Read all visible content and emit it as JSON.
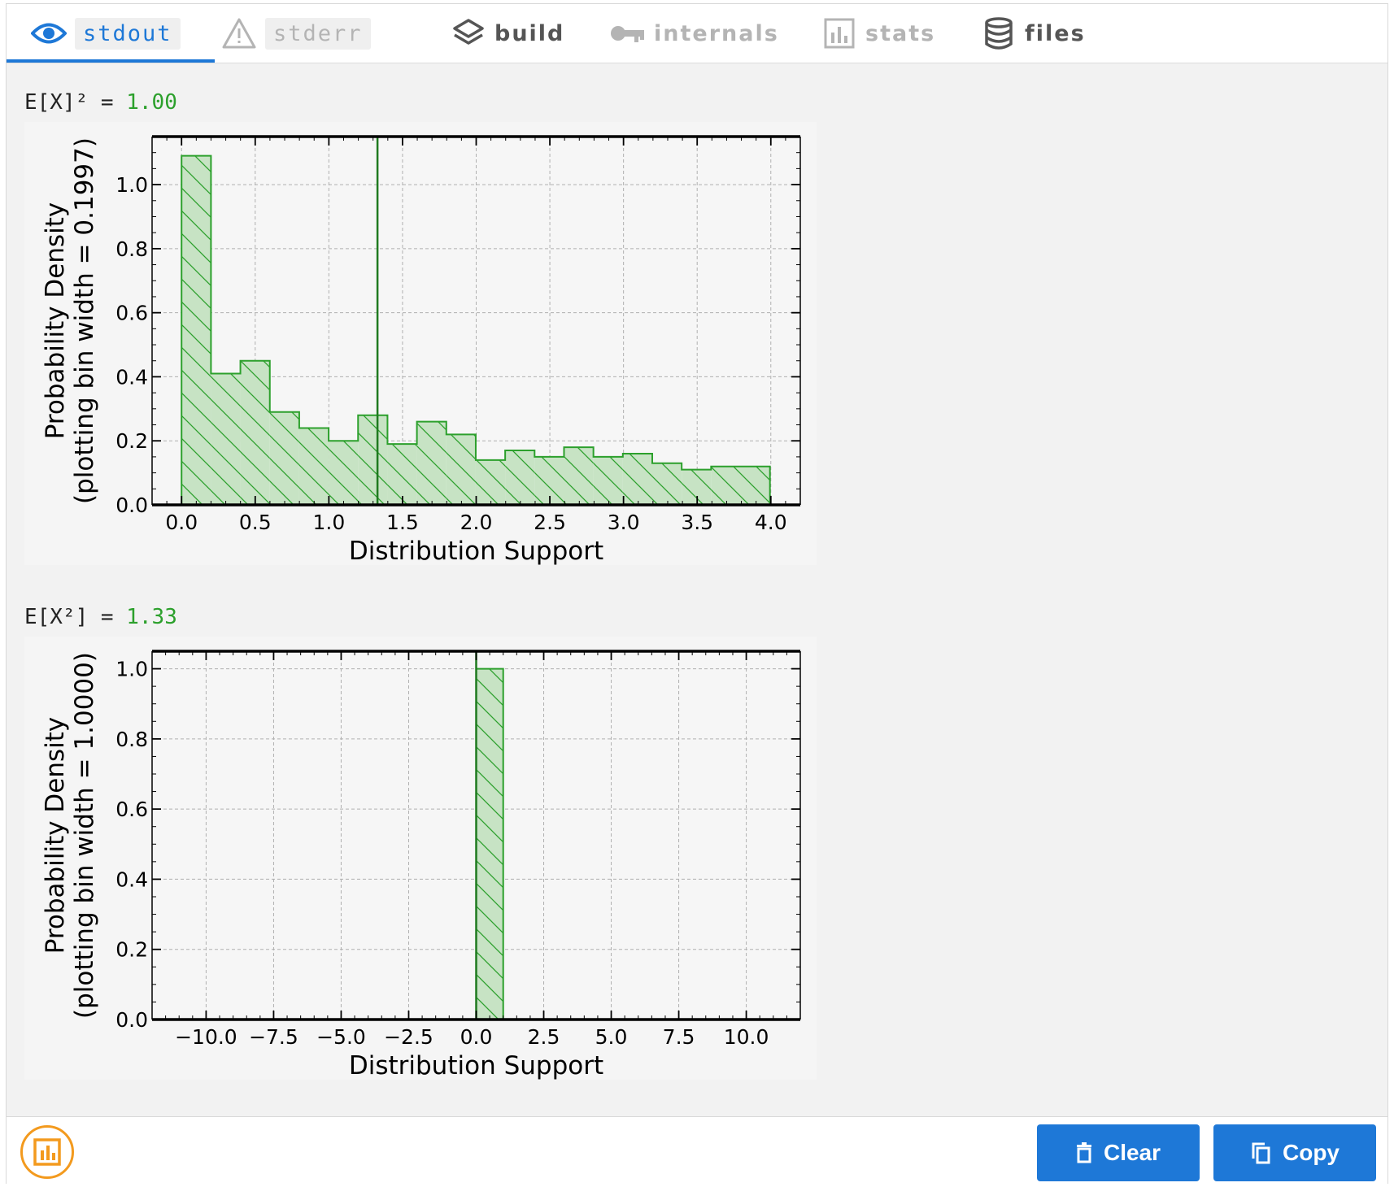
{
  "tabs": [
    {
      "label": "stdout",
      "icon": "eye-icon",
      "state": "active"
    },
    {
      "label": "stderr",
      "icon": "warning-icon",
      "state": "disabled"
    },
    {
      "label": "build",
      "icon": "layers-icon",
      "state": "normal"
    },
    {
      "label": "internals",
      "icon": "key-icon",
      "state": "disabled"
    },
    {
      "label": "stats",
      "icon": "bar-chart-icon",
      "state": "disabled"
    },
    {
      "label": "files",
      "icon": "database-icon",
      "state": "normal"
    }
  ],
  "outputs": [
    {
      "expr_label": "E[X]² = ",
      "expr_value": "1.00"
    },
    {
      "expr_label": "E[X²] = ",
      "expr_value": "1.33"
    }
  ],
  "footer": {
    "fab_icon": "bar-chart-icon",
    "clear_label": "Clear",
    "copy_label": "Copy"
  },
  "colors": {
    "accent": "#1e78d7",
    "hist_fill": "#c7e3c4",
    "hist_edge": "#2ca02c",
    "mean_line": "#1f7a1f",
    "fab": "#f39a1e"
  },
  "chart_data": [
    {
      "type": "bar",
      "title": "",
      "xlabel": "Distribution Support",
      "ylabel": "Probability Density\n(plotting bin width = 0.1997)",
      "xlim": [
        -0.2,
        4.2
      ],
      "ylim": [
        0.0,
        1.15
      ],
      "xticks": [
        0.0,
        0.5,
        1.0,
        1.5,
        2.0,
        2.5,
        3.0,
        3.5,
        4.0
      ],
      "xtick_labels": [
        "0.0",
        "0.5",
        "1.0",
        "1.5",
        "2.0",
        "2.5",
        "3.0",
        "3.5",
        "4.0"
      ],
      "yticks": [
        0.0,
        0.2,
        0.4,
        0.6,
        0.8,
        1.0
      ],
      "ytick_labels": [
        "0.0",
        "0.2",
        "0.4",
        "0.6",
        "0.8",
        "1.0"
      ],
      "grid": true,
      "bin_start": 0.0,
      "bin_width": 0.1997,
      "values": [
        1.09,
        0.41,
        0.45,
        0.29,
        0.24,
        0.2,
        0.28,
        0.19,
        0.26,
        0.22,
        0.14,
        0.17,
        0.15,
        0.18,
        0.15,
        0.16,
        0.13,
        0.11,
        0.12,
        0.12
      ],
      "vline": 1.33
    },
    {
      "type": "bar",
      "title": "",
      "xlabel": "Distribution Support",
      "ylabel": "Probability Density\n(plotting bin width = 1.0000)",
      "xlim": [
        -12.0,
        12.0
      ],
      "ylim": [
        0.0,
        1.05
      ],
      "xticks": [
        -10.0,
        -7.5,
        -5.0,
        -2.5,
        0.0,
        2.5,
        5.0,
        7.5,
        10.0
      ],
      "xtick_labels": [
        "−10.0",
        "−7.5",
        "−5.0",
        "−2.5",
        "0.0",
        "2.5",
        "5.0",
        "7.5",
        "10.0"
      ],
      "yticks": [
        0.0,
        0.2,
        0.4,
        0.6,
        0.8,
        1.0
      ],
      "ytick_labels": [
        "0.0",
        "0.2",
        "0.4",
        "0.6",
        "0.8",
        "1.0"
      ],
      "grid": true,
      "bin_start": 0.0,
      "bin_width": 1.0,
      "values": [
        1.0
      ],
      "vline": 0.0
    }
  ]
}
